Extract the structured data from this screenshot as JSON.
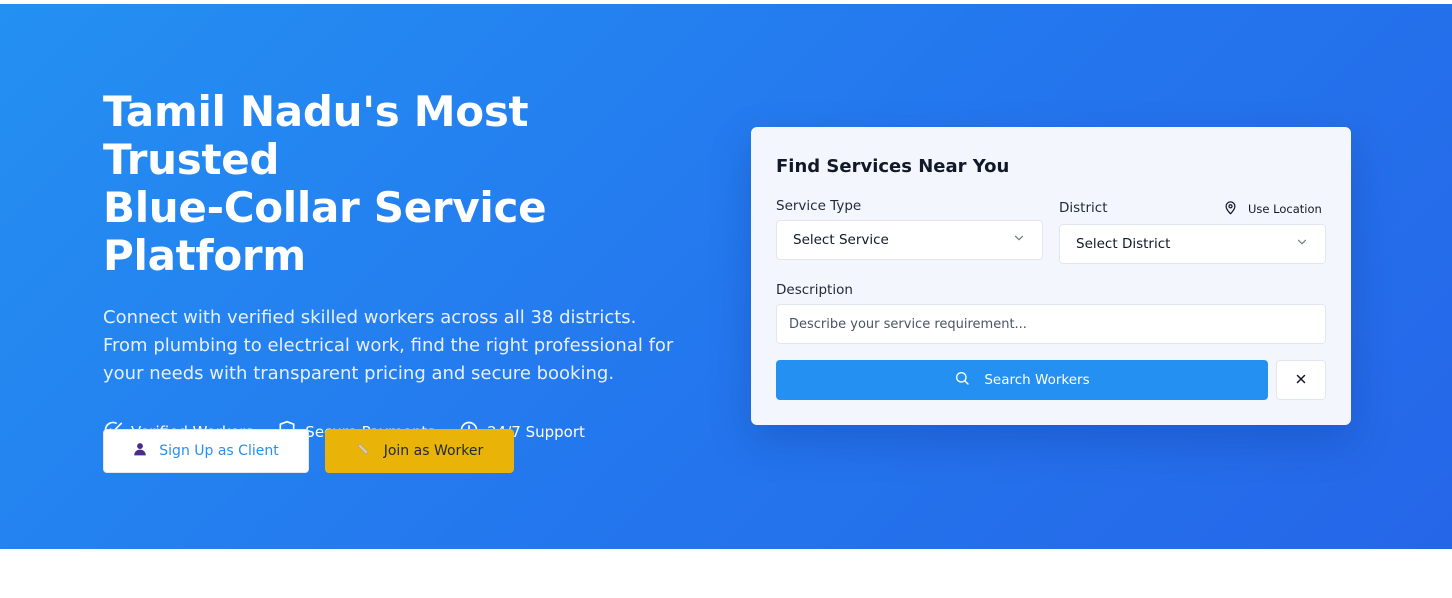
{
  "hero": {
    "title_line1": "Tamil Nadu's Most Trusted",
    "title_line2": "Blue-Collar Service",
    "title_line3": "Platform",
    "subtitle": "Connect with verified skilled workers across all 38 districts. From plumbing to electrical work, find the right professional for your needs with transparent pricing and secure booking.",
    "features": [
      {
        "icon": "check-circle-icon",
        "label": "Verified Workers"
      },
      {
        "icon": "shield-icon",
        "label": "Secure Payments"
      },
      {
        "icon": "clock-icon",
        "label": "24/7 Support"
      }
    ],
    "cta_client": {
      "icon": "user-icon",
      "label": "Sign Up as Client"
    },
    "cta_worker": {
      "icon": "wrench-icon",
      "label": "Join as Worker"
    }
  },
  "search_card": {
    "title": "Find Services Near You",
    "service_type_label": "Service Type",
    "service_type_value": "Select Service",
    "district_label": "District",
    "use_location_label": "Use Location",
    "district_value": "Select District",
    "description_label": "Description",
    "description_placeholder": "Describe your service requirement...",
    "search_button": "Search Workers"
  },
  "colors": {
    "hero_gradient_start": "#2490f2",
    "hero_gradient_end": "#2566e8",
    "primary": "#2490f2",
    "accent_yellow": "#e9b308",
    "card_bg": "#f3f6fc"
  }
}
